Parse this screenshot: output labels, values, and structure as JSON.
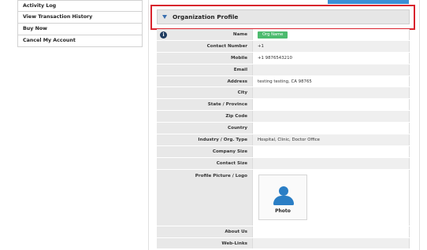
{
  "sidebar": {
    "items": [
      {
        "label": "Activity Log"
      },
      {
        "label": "View Transaction History"
      },
      {
        "label": "Buy Now"
      },
      {
        "label": "Cancel My Account"
      }
    ]
  },
  "section": {
    "title": "Organization Profile"
  },
  "colors": {
    "highlight_border": "#d9232d",
    "accent_blue": "#3a8fd6",
    "badge_green": "#4cbb6e",
    "photo_icon": "#2a7ec5"
  },
  "profile": {
    "info_icon": "i",
    "rows": [
      {
        "label": "Name",
        "value": "",
        "badge": "Org Name"
      },
      {
        "label": "Contact Number",
        "value": "+1"
      },
      {
        "label": "Mobile",
        "value": "+1 9876543210"
      },
      {
        "label": "Email",
        "value": ""
      },
      {
        "label": "Address",
        "value": "testing testing, CA 98765"
      },
      {
        "label": "City",
        "value": ""
      },
      {
        "label": "State / Province",
        "value": ""
      },
      {
        "label": "Zip Code",
        "value": ""
      },
      {
        "label": "Country",
        "value": ""
      },
      {
        "label": "Industry / Org. Type",
        "value": "Hospital, Clinic, Doctor Office"
      },
      {
        "label": "Company Size",
        "value": ""
      },
      {
        "label": "Contact Size",
        "value": ""
      },
      {
        "label": "Profile Picture / Logo",
        "photo_label": "Photo"
      },
      {
        "label": "About Us",
        "value": ""
      },
      {
        "label": "Web-Links",
        "value": ""
      }
    ]
  }
}
